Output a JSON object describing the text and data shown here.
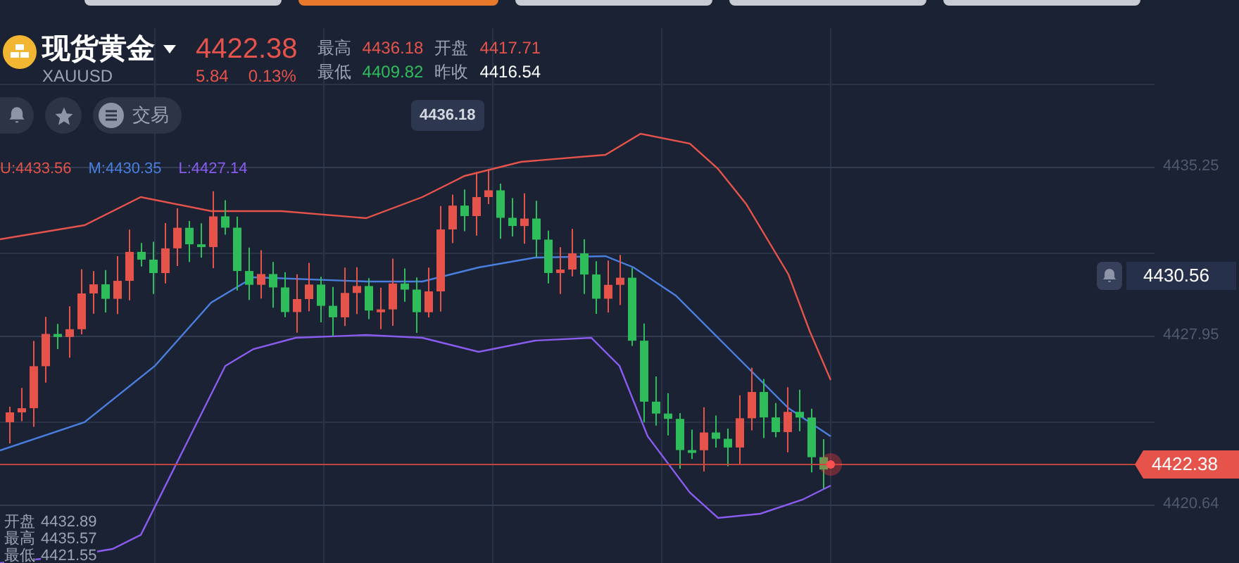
{
  "top_tabs": [
    {
      "selected": false
    },
    {
      "selected": true
    },
    {
      "selected": false
    },
    {
      "selected": false
    },
    {
      "selected": false
    }
  ],
  "header": {
    "title": "现货黄金",
    "symbol": "XAUUSD",
    "price": "4422.38",
    "change": "5.84",
    "change_pct": "0.13%",
    "stats": [
      {
        "label": "最高",
        "value": "4436.18",
        "color": "#e5534b"
      },
      {
        "label": "开盘",
        "value": "4417.71",
        "color": "#e5534b"
      },
      {
        "label": "最低",
        "value": "4409.82",
        "color": "#2ebd5a"
      },
      {
        "label": "昨收",
        "value": "4416.54",
        "color": "#ffffff"
      }
    ]
  },
  "actions": [
    {
      "kind": "alert"
    },
    {
      "kind": "favorite"
    },
    {
      "kind": "trade",
      "label": "交易"
    }
  ],
  "chart": {
    "bands": [
      {
        "label": "U:4433.56",
        "color": "#e5534b"
      },
      {
        "label": "M:4430.35",
        "color": "#4a7fe0"
      },
      {
        "label": "L:4427.14",
        "color": "#8a5cf0"
      }
    ],
    "tooltip": "4436.18",
    "y_labels": [
      "4435.25",
      "4427.95",
      "4420.64"
    ],
    "alert_price": "4430.56",
    "last_price": "4422.38",
    "ohlc": [
      {
        "label": "开盘",
        "value": "4432.89"
      },
      {
        "label": "最高",
        "value": "4435.57"
      },
      {
        "label": "最低",
        "value": "4421.55"
      }
    ]
  }
}
